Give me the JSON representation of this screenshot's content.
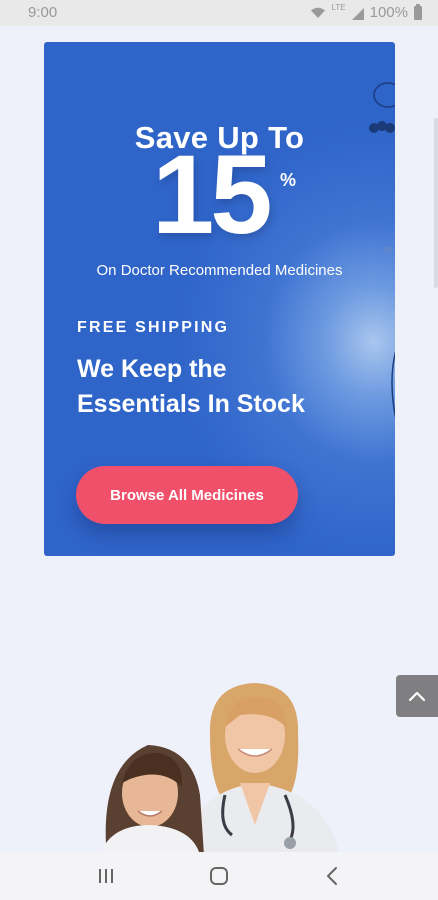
{
  "status_bar": {
    "time": "9:00",
    "network_label": "LTE",
    "battery": "100%"
  },
  "promo": {
    "headline": "Save Up To",
    "discount_number": "15",
    "discount_unit": "%",
    "subtext": "On Doctor Recommended Medicines",
    "tagline": "FREE SHIPPING",
    "heading_line1": "We Keep the",
    "heading_line2": "Essentials In Stock",
    "cta_label": "Browse All Medicines"
  },
  "icons": {
    "scroll_top": "chevron-up-icon",
    "nav_recents": "recent-apps-icon",
    "nav_home": "home-icon",
    "nav_back": "back-icon"
  },
  "colors": {
    "card_blue": "#2f64c9",
    "cta_pink": "#f0506a",
    "page_bg": "#eef0fa"
  }
}
